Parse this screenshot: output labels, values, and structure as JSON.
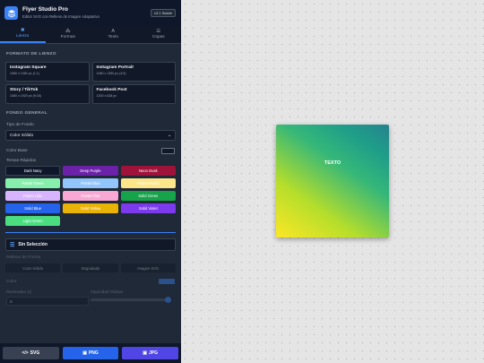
{
  "app": {
    "title": "Flyer Studio Pro",
    "subtitle": "Editor SVG con Relleno de Imagen Adaptativo",
    "version": "v3.1 Stable"
  },
  "tabs": [
    {
      "label": "Lienzo",
      "icon": "✖",
      "active": true
    },
    {
      "label": "Formas",
      "icon": "⁂",
      "active": false
    },
    {
      "label": "Texto",
      "icon": "A",
      "active": false
    },
    {
      "label": "Capas",
      "icon": "☰",
      "active": false
    }
  ],
  "canvas_format": {
    "title": "FORMATO DE LIENZO",
    "options": [
      {
        "name": "Instagram Square",
        "size": "1080 x 1080 px (1:1)"
      },
      {
        "name": "Instagram Portrait",
        "size": "1080 x 1350 px (4:5)"
      },
      {
        "name": "Story / TikTok",
        "size": "1080 x 1920 px (9:16)"
      },
      {
        "name": "Facebook Post",
        "size": "1200 x 628 px"
      }
    ]
  },
  "background": {
    "title": "FONDO GENERAL",
    "type_label": "Tipo de Fondo",
    "type_value": "Color Sólido",
    "base_color_label": "Color Base",
    "base_color": "#111827",
    "themes_label": "Temas Rápidos",
    "themes": [
      {
        "label": "Dark Navy",
        "bg": "#0f172a",
        "fg": "#ffffff"
      },
      {
        "label": "Deep Purple",
        "bg": "#6b21a8",
        "fg": "#ffffff"
      },
      {
        "label": "Neon Dusk",
        "bg": "#9f1239",
        "fg": "#ffffff"
      },
      {
        "label": "Pastel Green",
        "bg": "#86efac",
        "fg": "#ffffff"
      },
      {
        "label": "Pastel Blue",
        "bg": "#93c5fd",
        "fg": "#ffffff"
      },
      {
        "label": "Pastel Peach",
        "bg": "#fde68a",
        "fg": "#ffffff"
      },
      {
        "label": "Pastel Lilac",
        "bg": "#d8b4fe",
        "fg": "#ffffff"
      },
      {
        "label": "Pastel Pink",
        "bg": "#f9a8d4",
        "fg": "#ffffff"
      },
      {
        "label": "Solid Green",
        "bg": "#16a34a",
        "fg": "#ffffff"
      },
      {
        "label": "Solid Blue",
        "bg": "#2563eb",
        "fg": "#ffffff"
      },
      {
        "label": "Solid Yellow",
        "bg": "#eab308",
        "fg": "#ffffff"
      },
      {
        "label": "Solid Violet",
        "bg": "#7c3aed",
        "fg": "#ffffff"
      },
      {
        "label": "Light Green",
        "bg": "#4ade80",
        "fg": "#ffffff"
      }
    ]
  },
  "selection": {
    "title": "Sin Selección",
    "fill_label": "Relleno de Forma",
    "fill_options": [
      "Color Sólido",
      "Degradado",
      "Imagen SVG"
    ],
    "color_label": "Color",
    "color": "#3b82f6",
    "radius_label": "Redondeo (r)",
    "radius_value": "0",
    "opacity_label": "Opacidad Global",
    "opacity": 1.0
  },
  "export": {
    "svg": "SVG",
    "png": "PNG",
    "jpg": "JPG"
  },
  "artboard": {
    "text": "TEXTO"
  }
}
